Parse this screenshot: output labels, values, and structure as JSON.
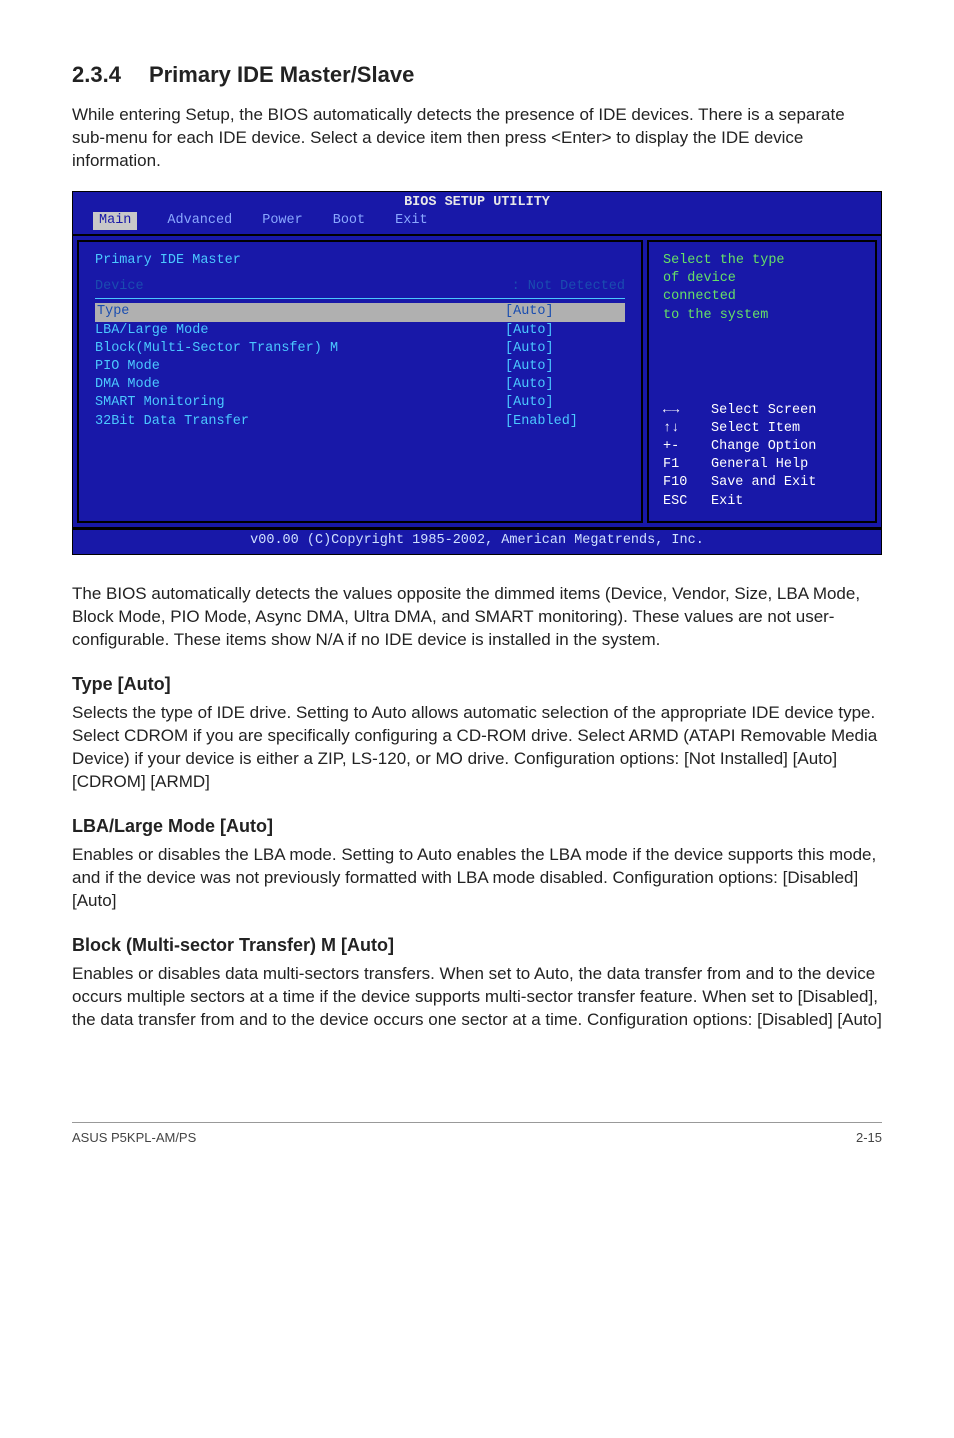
{
  "section": {
    "number": "2.3.4",
    "title": "Primary IDE Master/Slave"
  },
  "intro": "While entering Setup, the BIOS automatically detects the presence of IDE devices. There is a separate sub-menu for each IDE device. Select a device item then press <Enter> to display the IDE device information.",
  "bios": {
    "title": "BIOS SETUP UTILITY",
    "menu": [
      "Main",
      "Advanced",
      "Power",
      "Boot",
      "Exit"
    ],
    "menu_selected": "Main",
    "heading": "Primary IDE Master",
    "device_line": {
      "label": "Device",
      "value": ": Not Detected"
    },
    "rows": [
      {
        "label": "Type",
        "value": "[Auto]",
        "selected": true
      },
      {
        "label": "LBA/Large Mode",
        "value": "[Auto]",
        "selected": false
      },
      {
        "label": "Block(Multi-Sector Transfer) M",
        "value": "[Auto]",
        "selected": false
      },
      {
        "label": "PIO Mode",
        "value": "[Auto]",
        "selected": false
      },
      {
        "label": "DMA Mode",
        "value": "[Auto]",
        "selected": false
      },
      {
        "label": "SMART Monitoring",
        "value": "[Auto]",
        "selected": false
      },
      {
        "label": "32Bit Data Transfer",
        "value": "[Enabled]",
        "selected": false
      }
    ],
    "help_top": [
      "Select the type",
      "of device",
      "connected",
      "to the system"
    ],
    "help_keys": [
      {
        "k": "←→",
        "t": "Select Screen"
      },
      {
        "k": "↑↓",
        "t": "Select Item"
      },
      {
        "k": "+-",
        "t": "Change Option"
      },
      {
        "k": "F1",
        "t": "General Help"
      },
      {
        "k": "F10",
        "t": "Save and Exit"
      },
      {
        "k": "ESC",
        "t": "Exit"
      }
    ],
    "footer": "v00.00 (C)Copyright 1985-2002, American Megatrends, Inc."
  },
  "after_bios": "The BIOS automatically detects the values opposite the dimmed items (Device, Vendor, Size, LBA Mode, Block Mode, PIO Mode, Async DMA, Ultra DMA, and SMART monitoring). These values are not user-configurable. These items show N/A if no IDE device is installed in the system.",
  "type": {
    "heading": "Type [Auto]",
    "body": "Selects the type of IDE drive. Setting to Auto allows automatic selection of the appropriate IDE device type. Select CDROM if you are specifically configuring a CD-ROM drive. Select ARMD (ATAPI Removable Media Device) if your device is either a ZIP, LS-120, or MO drive. Configuration options: [Not Installed] [Auto] [CDROM] [ARMD]"
  },
  "lba": {
    "heading": "LBA/Large Mode [Auto]",
    "body": "Enables or disables the LBA mode. Setting to Auto enables the LBA mode if the device supports this mode, and if the device was not previously formatted with LBA mode disabled. Configuration options: [Disabled] [Auto]"
  },
  "block": {
    "heading": "Block (Multi-sector Transfer) M [Auto]",
    "body": "Enables or disables data multi-sectors transfers. When set to Auto, the data transfer from and to the device occurs multiple sectors at a time if the device supports multi-sector transfer feature. When set to [Disabled], the data transfer from and to the device occurs one sector at a time. Configuration options: [Disabled] [Auto]"
  },
  "footer": {
    "left": "ASUS P5KPL-AM/PS",
    "right": "2-15"
  }
}
